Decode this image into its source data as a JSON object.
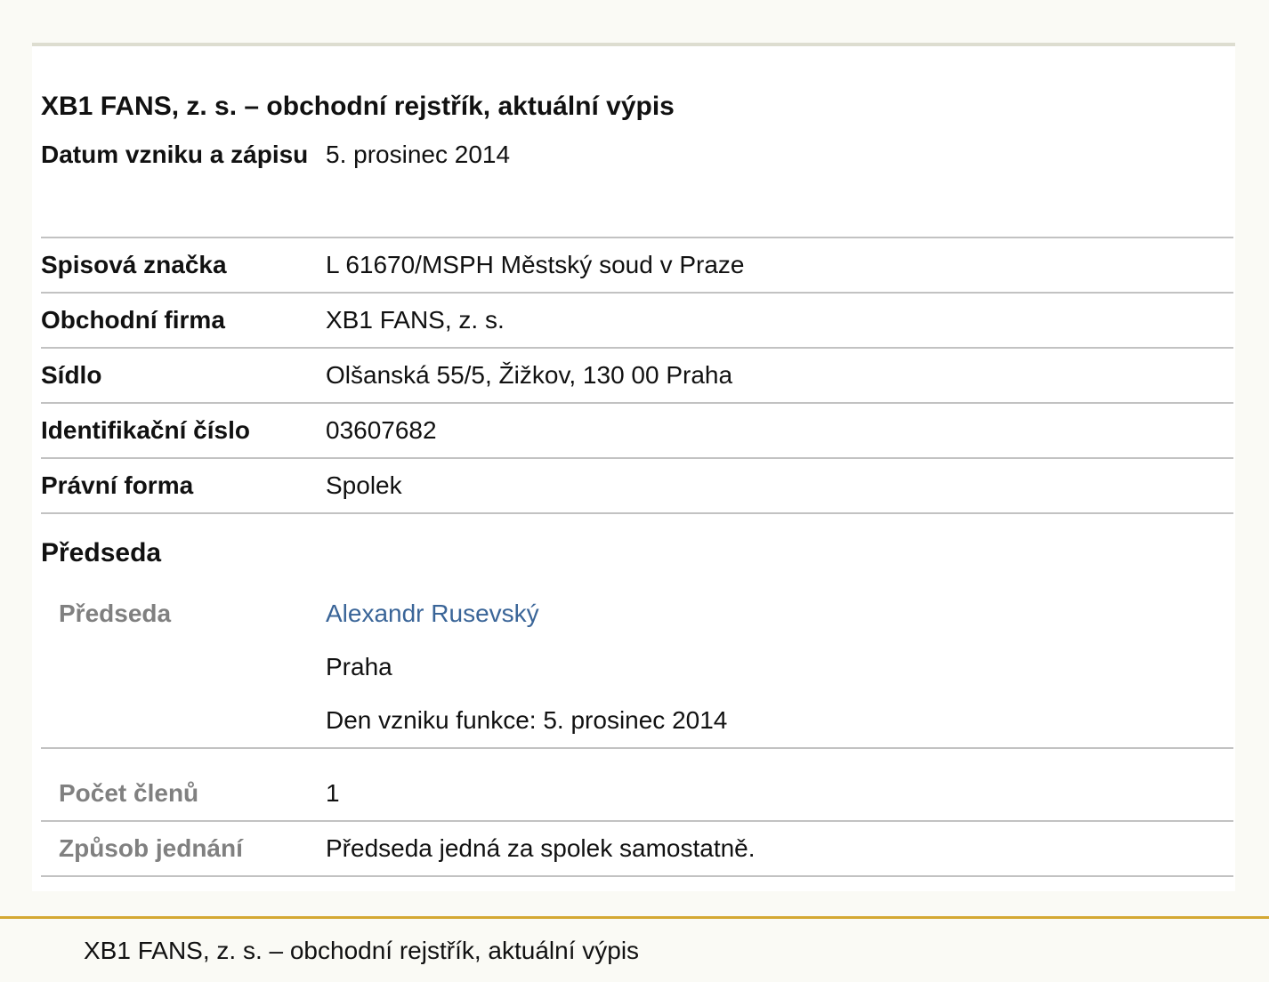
{
  "card": {
    "title": "XB1 FANS, z. s. – obchodní rejstřík, aktuální výpis",
    "rows": [
      {
        "label": "Datum vzniku a zápisu",
        "value": "5. prosinec 2014"
      },
      {
        "label": "Spisová značka",
        "value": "L 61670/MSPH Městský soud v Praze"
      },
      {
        "label": "Obchodní firma",
        "value": "XB1 FANS, z. s."
      },
      {
        "label": "Sídlo",
        "value": "Olšanská 55/5, Žižkov, 130 00 Praha"
      },
      {
        "label": "Identifikační číslo",
        "value": "03607682"
      },
      {
        "label": "Právní forma",
        "value": "Spolek"
      }
    ],
    "section": {
      "heading": "Předseda",
      "member": {
        "label": "Předseda",
        "name": "Alexandr Rusevský",
        "city": "Praha",
        "since": "Den vzniku funkce: 5. prosinec 2014"
      },
      "extra_rows": [
        {
          "label": "Počet členů",
          "value": "1"
        },
        {
          "label": "Způsob jednání",
          "value": "Předseda jedná za spolek samostatně."
        }
      ]
    }
  },
  "footer": {
    "text": "XB1 FANS, z. s. – obchodní rejstřík, aktuální výpis"
  },
  "colors": {
    "link": "#3a6598",
    "footer_border": "#d4a832",
    "muted_label": "#808080",
    "divider": "#c2c2c2"
  }
}
